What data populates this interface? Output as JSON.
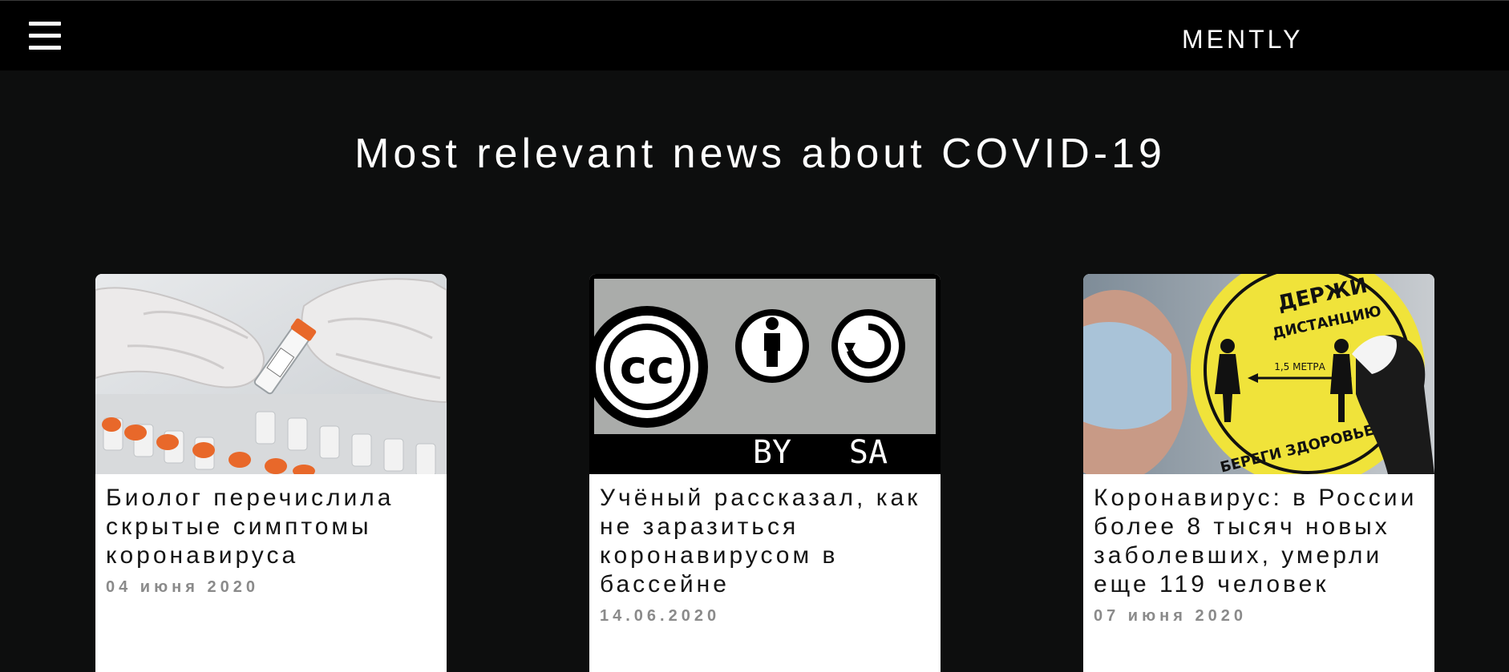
{
  "header": {
    "brand": "MENTLY"
  },
  "main": {
    "title": "Most relevant news about COVID-19"
  },
  "cards": [
    {
      "title": "Биолог перечислила скрытые симптомы коронавируса",
      "date": "04 июня 2020",
      "image": "lab-vials-gloves"
    },
    {
      "title": "Учёный рассказал, как не заразиться коронавирусом в бассейне",
      "date": "14.06.2020",
      "image": "cc-by-sa-license",
      "image_text": {
        "by": "BY",
        "sa": "SA"
      }
    },
    {
      "title": "Коронавирус: в России более 8 тысяч новых заболевших, умерли еще 119 человек",
      "date": "07 июня 2020",
      "image": "keep-distance-sign",
      "image_text": {
        "top": "ДЕРЖИ",
        "middle": "ДИСТАНЦИЮ",
        "distance": "1,5 МЕТРА",
        "bottom": "БЕРЕГИ ЗДОРОВЬЕ"
      }
    }
  ],
  "colors": {
    "page_bg": "#0d0e0e",
    "header_bg": "#000000",
    "card_bg": "#ffffff",
    "date_gray": "#8a8a8a"
  }
}
